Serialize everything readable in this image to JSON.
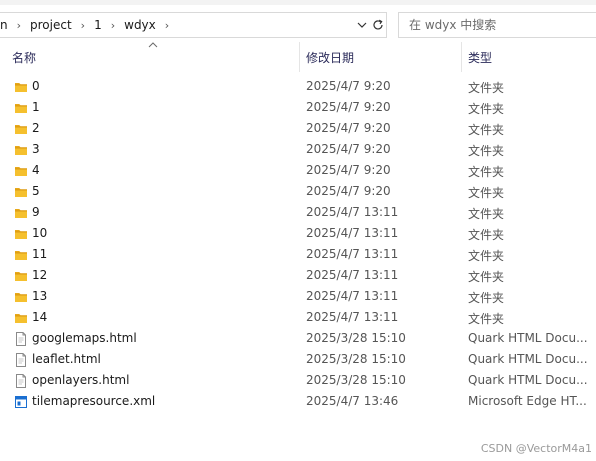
{
  "breadcrumb": [
    "n",
    "project",
    "1",
    "wdyx"
  ],
  "search": {
    "placeholder": "在 wdyx 中搜索"
  },
  "columns": {
    "name": "名称",
    "date": "修改日期",
    "type": "类型"
  },
  "files": [
    {
      "name": "0",
      "date": "2025/4/7 9:20",
      "type": "文件夹",
      "icon": "folder-icon"
    },
    {
      "name": "1",
      "date": "2025/4/7 9:20",
      "type": "文件夹",
      "icon": "folder-icon"
    },
    {
      "name": "2",
      "date": "2025/4/7 9:20",
      "type": "文件夹",
      "icon": "folder-icon"
    },
    {
      "name": "3",
      "date": "2025/4/7 9:20",
      "type": "文件夹",
      "icon": "folder-icon"
    },
    {
      "name": "4",
      "date": "2025/4/7 9:20",
      "type": "文件夹",
      "icon": "folder-icon"
    },
    {
      "name": "5",
      "date": "2025/4/7 9:20",
      "type": "文件夹",
      "icon": "folder-icon"
    },
    {
      "name": "9",
      "date": "2025/4/7 13:11",
      "type": "文件夹",
      "icon": "folder-icon"
    },
    {
      "name": "10",
      "date": "2025/4/7 13:11",
      "type": "文件夹",
      "icon": "folder-icon"
    },
    {
      "name": "11",
      "date": "2025/4/7 13:11",
      "type": "文件夹",
      "icon": "folder-icon"
    },
    {
      "name": "12",
      "date": "2025/4/7 13:11",
      "type": "文件夹",
      "icon": "folder-icon"
    },
    {
      "name": "13",
      "date": "2025/4/7 13:11",
      "type": "文件夹",
      "icon": "folder-icon"
    },
    {
      "name": "14",
      "date": "2025/4/7 13:11",
      "type": "文件夹",
      "icon": "folder-icon"
    },
    {
      "name": "googlemaps.html",
      "date": "2025/3/28 15:10",
      "type": "Quark HTML Docu...",
      "icon": "html-file-icon"
    },
    {
      "name": "leaflet.html",
      "date": "2025/3/28 15:10",
      "type": "Quark HTML Docu...",
      "icon": "html-file-icon"
    },
    {
      "name": "openlayers.html",
      "date": "2025/3/28 15:10",
      "type": "Quark HTML Docu...",
      "icon": "html-file-icon"
    },
    {
      "name": "tilemapresource.xml",
      "date": "2025/4/7 13:46",
      "type": "Microsoft Edge HT...",
      "icon": "xml-file-icon"
    }
  ],
  "watermark": "CSDN @VectorM4a1",
  "colors": {
    "folder": "#e8a91b",
    "folder_dark": "#d4900a",
    "header_text": "#2b2b5a",
    "xml_blue": "#1a6fd1"
  }
}
